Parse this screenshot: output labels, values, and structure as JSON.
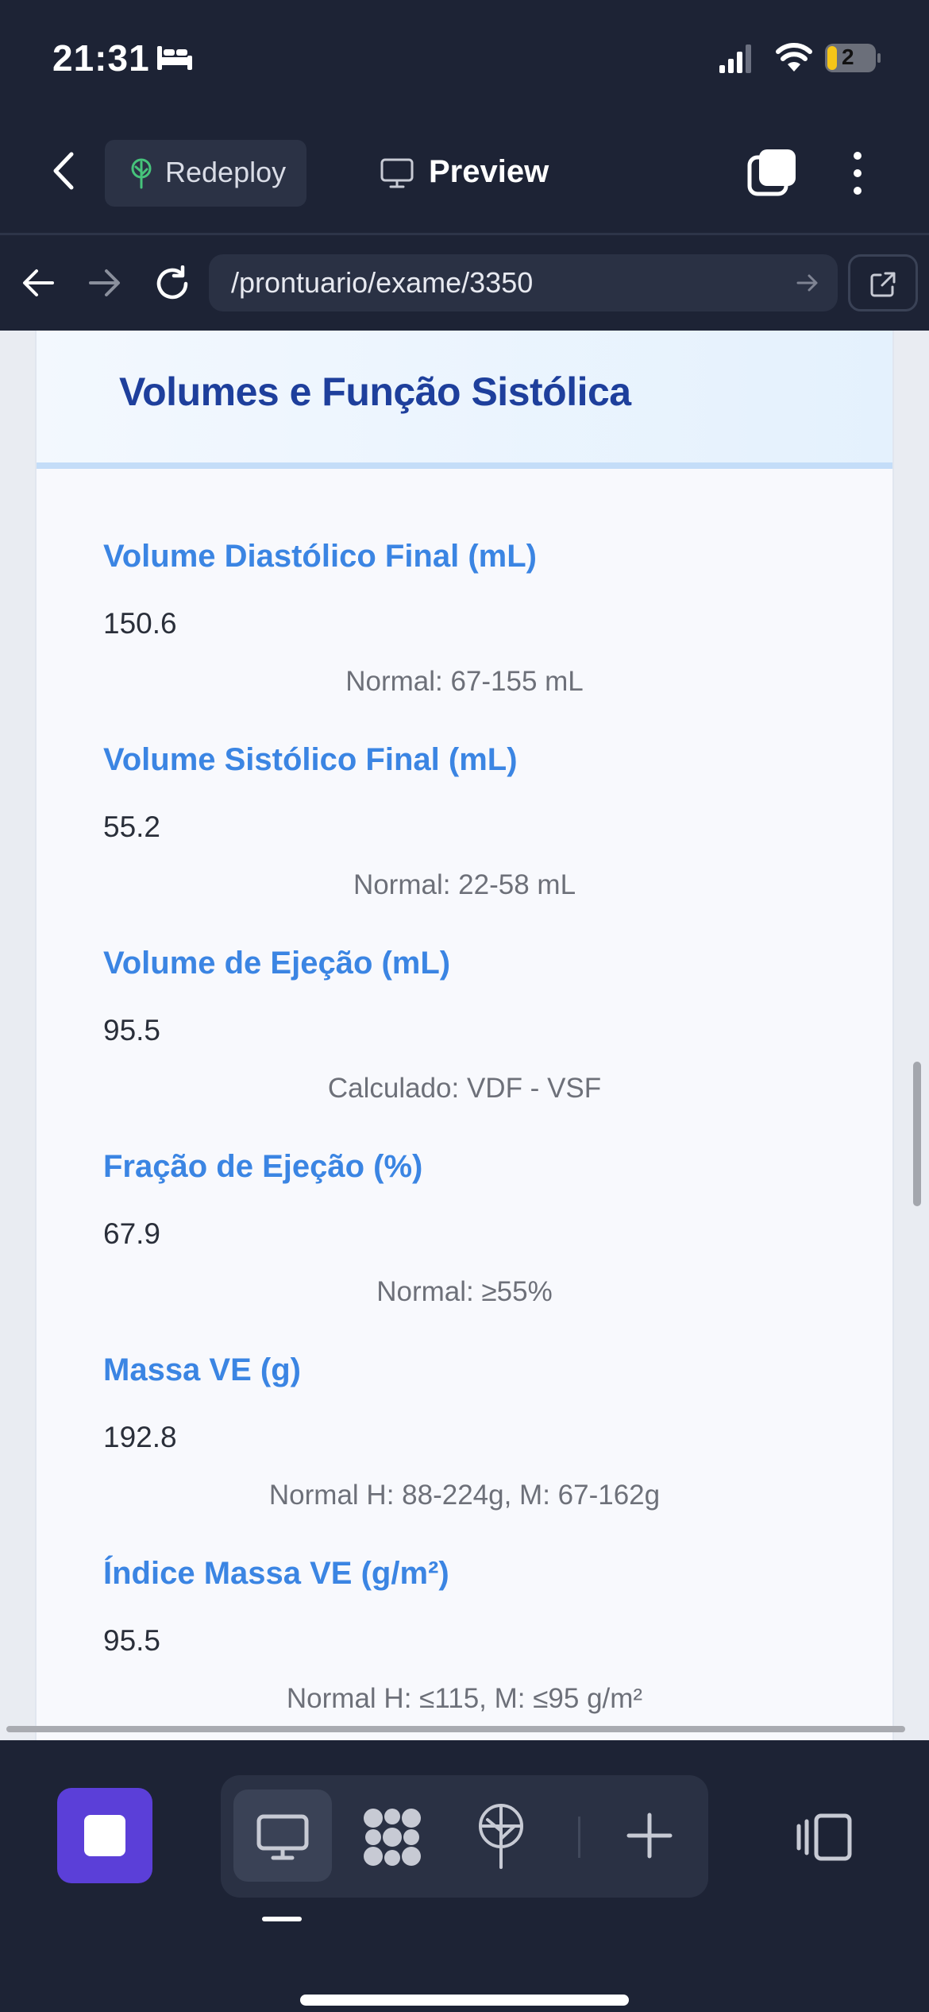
{
  "status_bar": {
    "time": "21:31",
    "battery_level": "2",
    "icons": [
      "bed-icon",
      "cell-signal-icon",
      "wifi-icon",
      "battery-icon"
    ]
  },
  "app_bar": {
    "redeploy_label": "Redeploy",
    "preview_label": "Preview",
    "icons": [
      "back-chevron-icon",
      "tree-icon",
      "monitor-icon",
      "tabs-icon",
      "kebab-menu-icon"
    ]
  },
  "browser": {
    "url": "/prontuario/exame/3350",
    "icons": [
      "arrow-left-icon",
      "arrow-right-icon",
      "reload-icon",
      "arrow-right-small-icon",
      "external-link-icon"
    ]
  },
  "card": {
    "title": "Volumes e Função Sistólica",
    "fields": [
      {
        "label": "Volume Diastólico Final (mL)",
        "value": "150.6",
        "note": "Normal: 67-155 mL"
      },
      {
        "label": "Volume Sistólico Final (mL)",
        "value": "55.2",
        "note": "Normal: 22-58 mL"
      },
      {
        "label": "Volume de Ejeção (mL)",
        "value": "95.5",
        "note": "Calculado: VDF - VSF"
      },
      {
        "label": "Fração de Ejeção (%)",
        "value": "67.9",
        "note": "Normal: ≥55%"
      },
      {
        "label": "Massa VE (g)",
        "value": "192.8",
        "note": "Normal H: 88-224g, M: 67-162g"
      },
      {
        "label": "Índice Massa VE (g/m²)",
        "value": "95.5",
        "note": "Normal H: ≤115, M: ≤95 g/m²"
      }
    ]
  },
  "bottom_toolbar": {
    "icons": [
      "stop-icon",
      "desktop-icon",
      "nodes-icon",
      "deploy-icon",
      "plus-icon",
      "panel-toggle-icon"
    ],
    "selected": "desktop-icon"
  },
  "colors": {
    "dark_bg": "#1d2335",
    "accent_purple": "#5b3fd8",
    "title_blue": "#1e3f9c",
    "label_blue": "#3b85e3"
  }
}
